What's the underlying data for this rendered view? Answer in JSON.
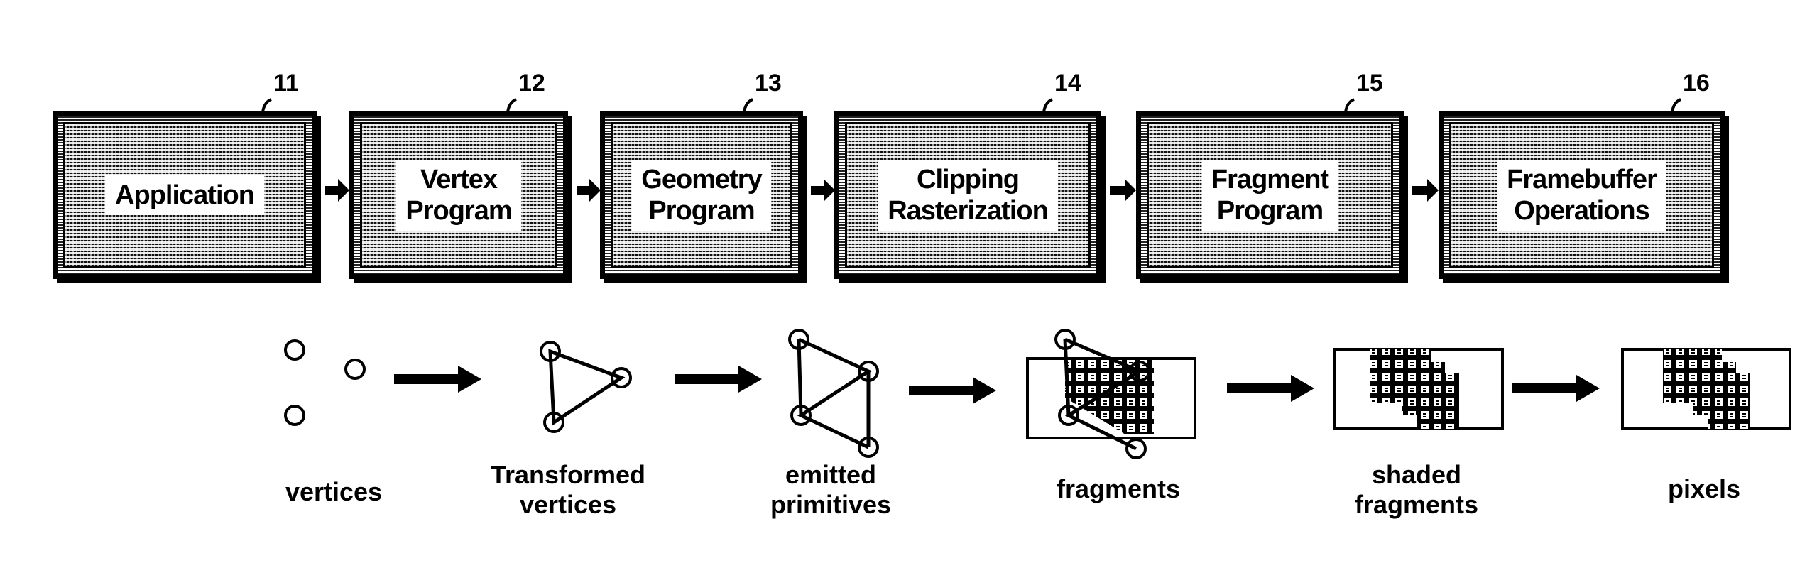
{
  "pipeline": {
    "stages": [
      {
        "ref": "11",
        "label": "Application"
      },
      {
        "ref": "12",
        "label": "Vertex\nProgram"
      },
      {
        "ref": "13",
        "label": "Geometry\nProgram"
      },
      {
        "ref": "14",
        "label": "Clipping\nRasterization"
      },
      {
        "ref": "15",
        "label": "Fragment\nProgram"
      },
      {
        "ref": "16",
        "label": "Framebuffer\nOperations"
      }
    ]
  },
  "data_flow": {
    "captions": [
      {
        "label": "vertices"
      },
      {
        "label": "Transformed\nvertices"
      },
      {
        "label": "emitted\nprimitives"
      },
      {
        "label": "fragments"
      },
      {
        "label": "shaded\nfragments"
      },
      {
        "label": "pixels"
      }
    ]
  }
}
